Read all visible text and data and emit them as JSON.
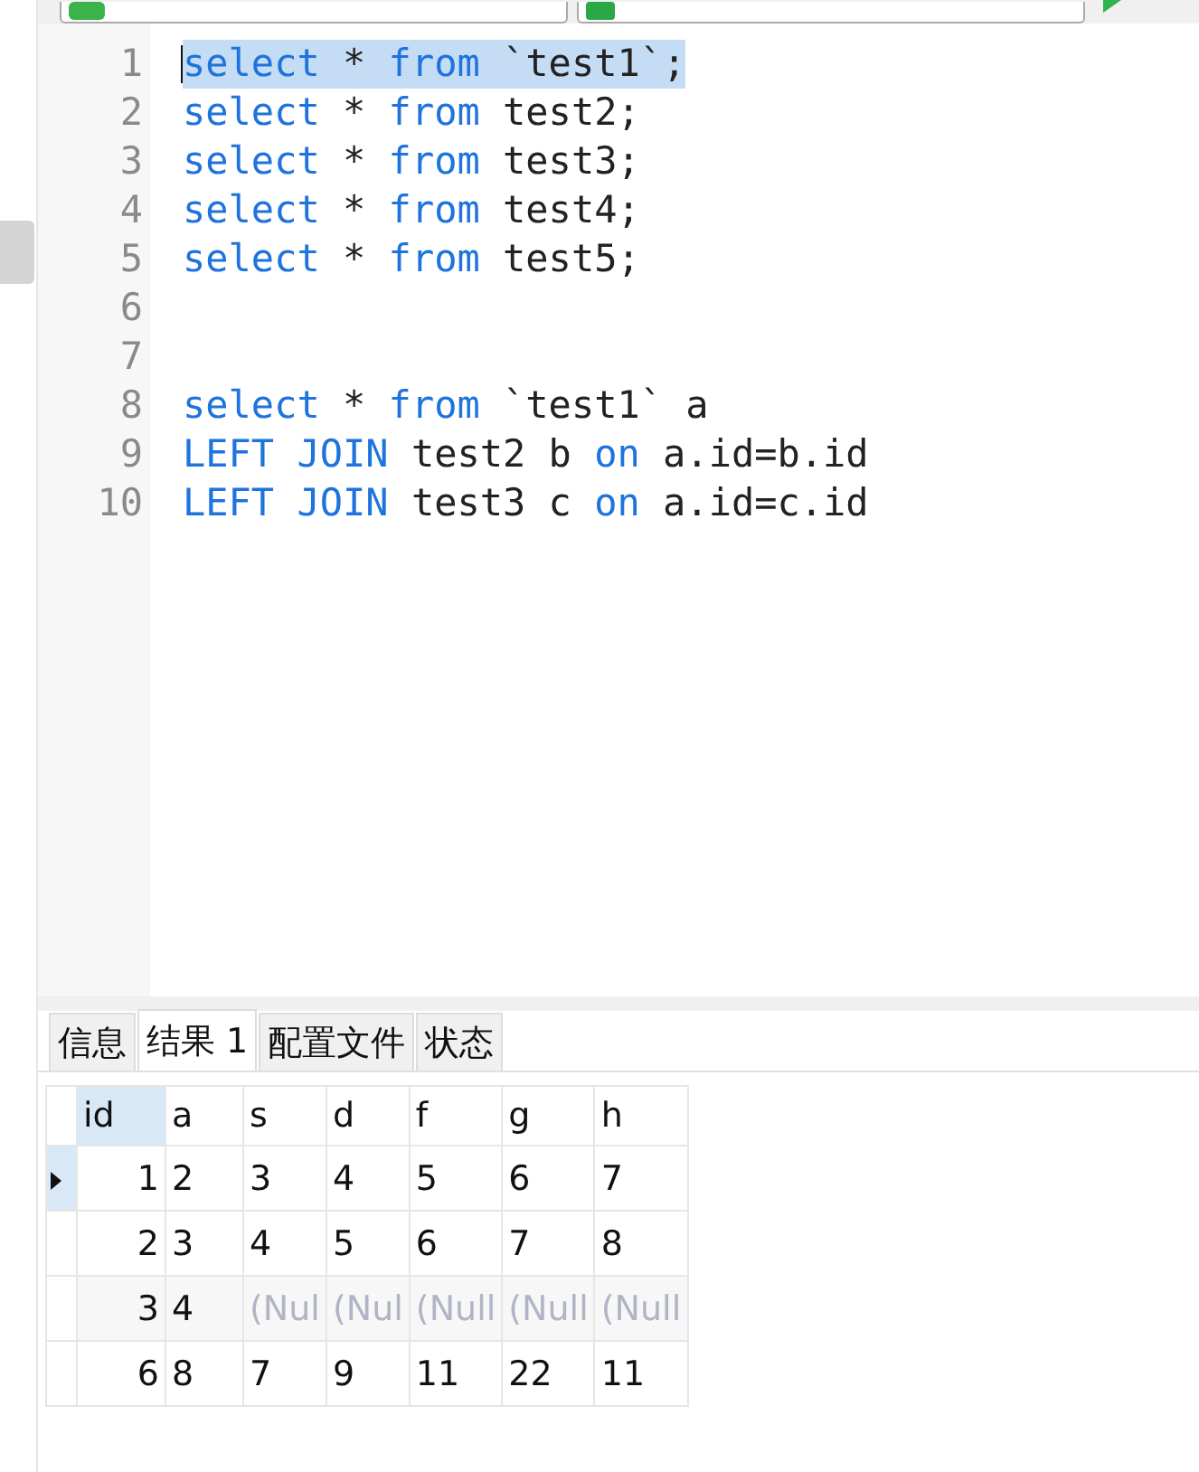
{
  "editor": {
    "lines": [
      {
        "number": "1",
        "selected": true,
        "tokens": [
          {
            "text": "select",
            "kind": "keyword"
          },
          {
            "text": " * ",
            "kind": "plain"
          },
          {
            "text": "from",
            "kind": "keyword"
          },
          {
            "text": " `test1`;",
            "kind": "plain"
          }
        ]
      },
      {
        "number": "2",
        "selected": false,
        "tokens": [
          {
            "text": "select",
            "kind": "keyword"
          },
          {
            "text": " * ",
            "kind": "plain"
          },
          {
            "text": "from",
            "kind": "keyword"
          },
          {
            "text": " test2;",
            "kind": "plain"
          }
        ]
      },
      {
        "number": "3",
        "selected": false,
        "tokens": [
          {
            "text": "select",
            "kind": "keyword"
          },
          {
            "text": " * ",
            "kind": "plain"
          },
          {
            "text": "from",
            "kind": "keyword"
          },
          {
            "text": " test3;",
            "kind": "plain"
          }
        ]
      },
      {
        "number": "4",
        "selected": false,
        "tokens": [
          {
            "text": "select",
            "kind": "keyword"
          },
          {
            "text": " * ",
            "kind": "plain"
          },
          {
            "text": "from",
            "kind": "keyword"
          },
          {
            "text": " test4;",
            "kind": "plain"
          }
        ]
      },
      {
        "number": "5",
        "selected": false,
        "tokens": [
          {
            "text": "select",
            "kind": "keyword"
          },
          {
            "text": " * ",
            "kind": "plain"
          },
          {
            "text": "from",
            "kind": "keyword"
          },
          {
            "text": " test5;",
            "kind": "plain"
          }
        ]
      },
      {
        "number": "6",
        "selected": false
      },
      {
        "number": "7",
        "selected": false
      },
      {
        "number": "8",
        "selected": false,
        "tokens": [
          {
            "text": "select",
            "kind": "keyword"
          },
          {
            "text": " * ",
            "kind": "plain"
          },
          {
            "text": "from",
            "kind": "keyword"
          },
          {
            "text": " `test1` a",
            "kind": "plain"
          }
        ]
      },
      {
        "number": "9",
        "selected": false,
        "tokens": [
          {
            "text": "LEFT JOIN",
            "kind": "keyword"
          },
          {
            "text": " test2 b ",
            "kind": "plain"
          },
          {
            "text": "on",
            "kind": "keyword"
          },
          {
            "text": " a.id=b.id",
            "kind": "plain"
          }
        ]
      },
      {
        "number": "10",
        "selected": false,
        "tokens": [
          {
            "text": "LEFT JOIN",
            "kind": "keyword"
          },
          {
            "text": " test3 c ",
            "kind": "plain"
          },
          {
            "text": "on",
            "kind": "keyword"
          },
          {
            "text": " a.id=c.id",
            "kind": "plain"
          }
        ]
      }
    ]
  },
  "tabs": [
    {
      "label": "信息",
      "selected": false
    },
    {
      "label": "结果 1",
      "selected": true
    },
    {
      "label": "配置文件",
      "selected": false
    },
    {
      "label": "状态",
      "selected": false
    }
  ],
  "table": {
    "columns": [
      "id",
      "a",
      "s",
      "d",
      "f",
      "g",
      "h"
    ],
    "rows": [
      {
        "current": true,
        "cells": [
          {
            "text": "1",
            "kind": "num"
          },
          {
            "text": "2",
            "kind": "value"
          },
          {
            "text": "3",
            "kind": "value"
          },
          {
            "text": "4",
            "kind": "value"
          },
          {
            "text": "5",
            "kind": "value"
          },
          {
            "text": "6",
            "kind": "value"
          },
          {
            "text": "7",
            "kind": "value"
          }
        ]
      },
      {
        "current": false,
        "cells": [
          {
            "text": "2",
            "kind": "num"
          },
          {
            "text": "3",
            "kind": "value"
          },
          {
            "text": "4",
            "kind": "value"
          },
          {
            "text": "5",
            "kind": "value"
          },
          {
            "text": "6",
            "kind": "value"
          },
          {
            "text": "7",
            "kind": "value"
          },
          {
            "text": "8",
            "kind": "value"
          }
        ]
      },
      {
        "current": false,
        "cells": [
          {
            "text": "3",
            "kind": "num"
          },
          {
            "text": "4",
            "kind": "value"
          },
          {
            "text": "(Nul",
            "kind": "null"
          },
          {
            "text": "(Nul",
            "kind": "null"
          },
          {
            "text": "(Null",
            "kind": "null"
          },
          {
            "text": "(Null",
            "kind": "null"
          },
          {
            "text": "(Null",
            "kind": "null"
          }
        ]
      },
      {
        "current": false,
        "cells": [
          {
            "text": "6",
            "kind": "num"
          },
          {
            "text": "8",
            "kind": "value"
          },
          {
            "text": "7",
            "kind": "value"
          },
          {
            "text": "9",
            "kind": "value"
          },
          {
            "text": "11",
            "kind": "value"
          },
          {
            "text": "22",
            "kind": "value"
          },
          {
            "text": "11",
            "kind": "value"
          }
        ]
      }
    ]
  }
}
